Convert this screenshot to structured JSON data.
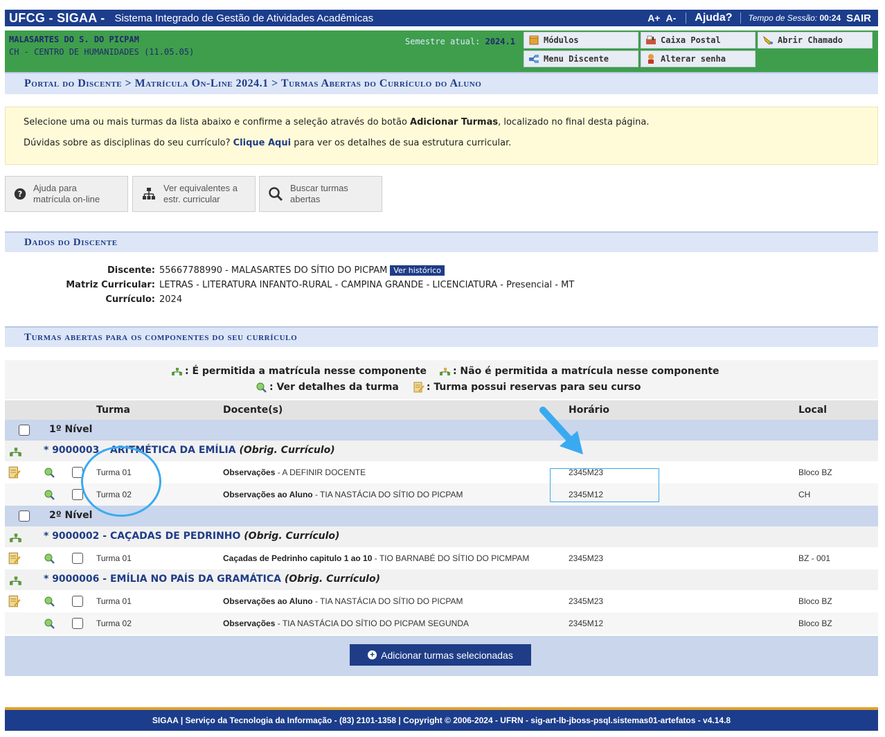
{
  "topbar": {
    "brand": "UFCG - SIGAA -",
    "system_name": "Sistema Integrado de Gestão de Atividades Acadêmicas",
    "font_increase": "A+",
    "font_decrease": "A-",
    "help": "Ajuda?",
    "session_label": "Tempo de Sessão:",
    "session_time": "00:24",
    "logout": "SAIR"
  },
  "user": {
    "name": "MALASARTES DO S. DO PICPAM",
    "centro": "CH - CENTRO DE HUMANIDADES (11.05.05)",
    "semester_label": "Semestre atual:",
    "semester_value": "2024.1"
  },
  "menu_buttons": {
    "modulos": "Módulos",
    "caixa_postal": "Caixa Postal",
    "abrir_chamado": "Abrir Chamado",
    "menu_discente": "Menu Discente",
    "alterar_senha": "Alterar senha"
  },
  "breadcrumb": "Portal do Discente > Matrícula On-Line 2024.1 > Turmas Abertas do Currículo do Aluno",
  "info": {
    "line1_pre": "Selecione uma ou mais turmas da lista abaixo e confirme a seleção através do botão ",
    "line1_bold": "Adicionar Turmas",
    "line1_post": ", localizado no final desta página.",
    "line2_pre": "Dúvidas sobre as disciplinas do seu currículo? ",
    "line2_link": "Clique Aqui",
    "line2_post": " para ver os detalhes de sua estrutura curricular."
  },
  "actions": {
    "help_l1": "Ajuda para",
    "help_l2": "matrícula on-line",
    "equiv_l1": "Ver equivalentes a",
    "equiv_l2": "estr. curricular",
    "search_l1": "Buscar turmas",
    "search_l2": "abertas"
  },
  "dados": {
    "title": "Dados do Discente",
    "discente_label": "Discente:",
    "discente_value": "55667788990 - MALASARTES DO SÍTIO DO PICPAM",
    "historico": "Ver histórico",
    "matriz_label": "Matriz Curricular:",
    "matriz_value": "LETRAS - LITERATURA INFANTO-RURAL - CAMPINA GRANDE - LICENCIATURA - Presencial - MT",
    "curriculo_label": "Currículo:",
    "curriculo_value": "2024"
  },
  "turmas_title": "Turmas abertas para os componentes do seu currículo",
  "legend": {
    "permitida": ": É permitida a matrícula nesse componente",
    "nao_permitida": ": Não é permitida a matrícula nesse componente",
    "detalhes": ": Ver detalhes da turma",
    "reservas": ": Turma possui reservas para seu curso"
  },
  "columns": {
    "turma": "Turma",
    "docente": "Docente(s)",
    "horario": "Horário",
    "local": "Local"
  },
  "niveis": [
    "1º Nível",
    "2º Nível"
  ],
  "componentes": [
    {
      "title": "* 9000003 - ARITMÉTICA DA EMÍLIA",
      "tag": "(Obrig. Currículo)",
      "turmas": [
        {
          "turma": "Turma 01",
          "doc_bold": "Observações",
          "doc_rest": " - A DEFINIR DOCENTE",
          "horario": "2345M23",
          "local": "Bloco BZ"
        },
        {
          "turma": "Turma 02",
          "doc_bold": "Observações ao Aluno",
          "doc_rest": " - TIA NASTÁCIA DO SÍTIO DO PICPAM",
          "horario": "2345M12",
          "local": "CH"
        }
      ]
    },
    {
      "title": "* 9000002 - CAÇADAS DE PEDRINHO",
      "tag": "(Obrig. Currículo)",
      "turmas": [
        {
          "turma": "Turma 01",
          "doc_bold": "Caçadas de Pedrinho capitulo 1 ao 10",
          "doc_rest": " - TIO BARNABÉ DO SÍTIO DO PICMPAM",
          "horario": "2345M23",
          "local": "BZ - 001"
        }
      ]
    },
    {
      "title": "* 9000006 - EMÍLIA NO PAÍS DA GRAMÁTICA",
      "tag": "(Obrig. Currículo)",
      "turmas": [
        {
          "turma": "Turma 01",
          "doc_bold": "Observações ao Aluno",
          "doc_rest": " - TIA NASTÁCIA DO SÍTIO DO PICPAM",
          "horario": "2345M23",
          "local": "Bloco BZ"
        },
        {
          "turma": "Turma 02",
          "doc_bold": "Observações",
          "doc_rest": " - TIA NASTÁCIA DO SÍTIO DO PICPAM SEGUNDA",
          "horario": "2345M12",
          "local": "Bloco BZ"
        }
      ]
    }
  ],
  "add_button": "Adicionar turmas selecionadas",
  "footer": "SIGAA | Serviço da Tecnologia da Informação - (83) 2101-1358 | Copyright © 2006-2024 - UFRN - sig-art-lb-jboss-psql.sistemas01-artefatos - v4.14.8",
  "colors": {
    "navy": "#1c3d8c",
    "green": "#3e9e4c",
    "annotation": "#3aaaf0",
    "info_bg": "#fffbd8"
  }
}
